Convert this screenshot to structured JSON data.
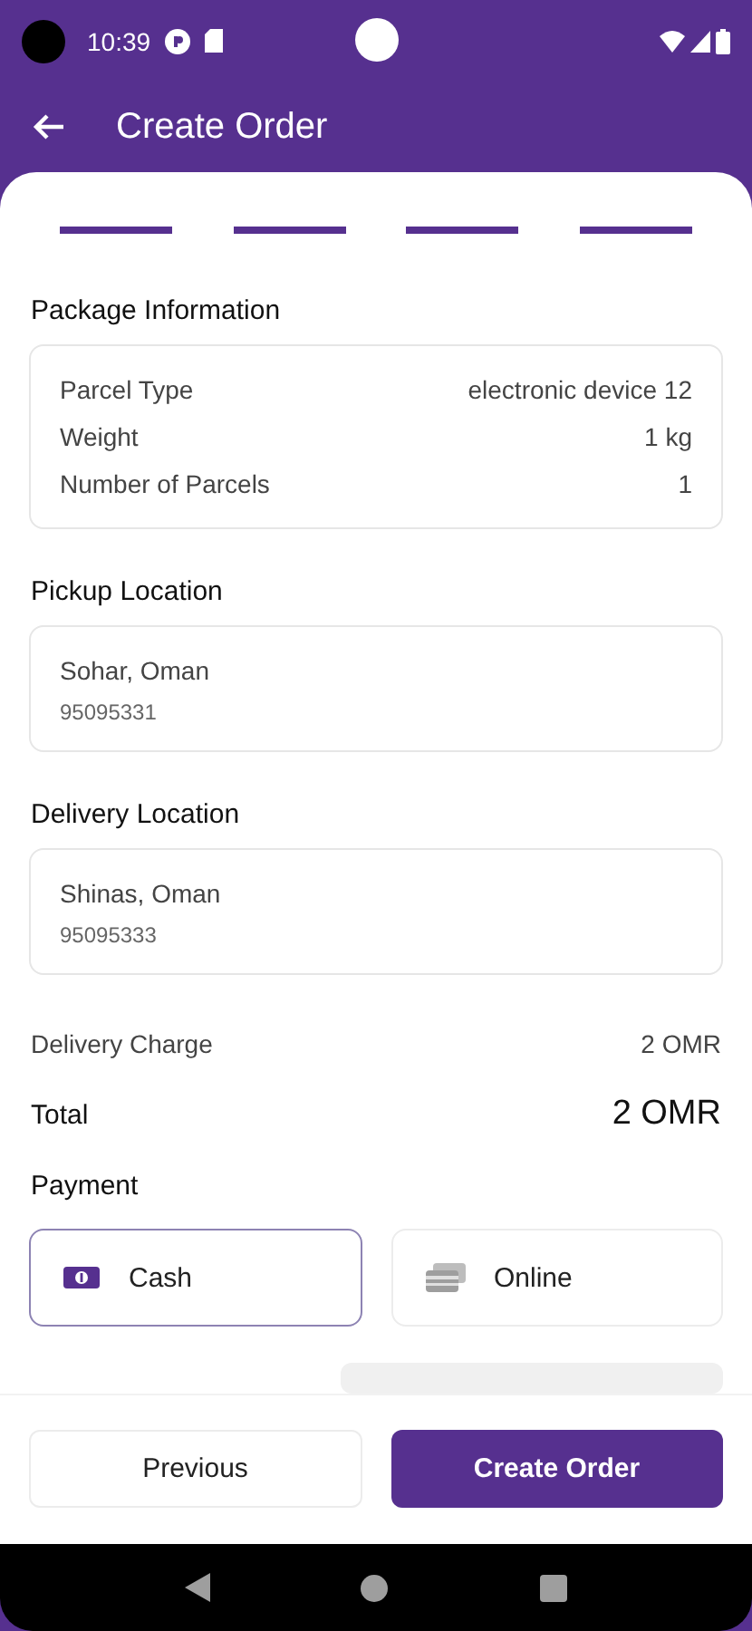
{
  "status_bar": {
    "time": "10:39"
  },
  "app_bar": {
    "title": "Create Order"
  },
  "progress_steps": [
    {
      "completed": true
    },
    {
      "completed": true
    },
    {
      "completed": true
    },
    {
      "completed": true
    }
  ],
  "package_information": {
    "heading": "Package Information",
    "rows": [
      {
        "label": "Parcel Type",
        "value": "electronic device 12"
      },
      {
        "label": "Weight",
        "value": "1 kg"
      },
      {
        "label": "Number of Parcels",
        "value": "1"
      }
    ]
  },
  "pickup_location": {
    "heading": "Pickup Location",
    "address": "Sohar, Oman",
    "phone": "95095331"
  },
  "delivery_location": {
    "heading": "Delivery Location",
    "address": "Shinas, Oman",
    "phone": "95095333"
  },
  "delivery_charge": {
    "label": "Delivery Charge",
    "value": "2 OMR"
  },
  "total": {
    "label": "Total",
    "value": "2 OMR"
  },
  "payment": {
    "heading": "Payment",
    "options": [
      {
        "kind": "cash",
        "label": "Cash",
        "selected": true
      },
      {
        "kind": "online",
        "label": "Online",
        "selected": false
      }
    ]
  },
  "buttons": {
    "previous": "Previous",
    "create": "Create Order"
  }
}
